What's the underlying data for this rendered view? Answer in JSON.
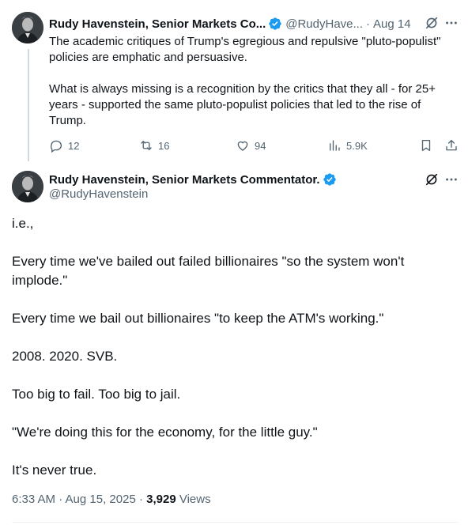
{
  "tweet1": {
    "author_name": "Rudy Havenstein, Senior Markets Co...",
    "handle": "@RudyHave...",
    "separator": "·",
    "date": "Aug 14",
    "paragraphs": [
      "The academic critiques of Trump's egregious and repulsive \"pluto-populist\" policies are emphatic and persuasive.",
      "What is always missing is a recognition by the critics that they all - for 25+ years - supported the same pluto-populist policies that led to the rise of Trump."
    ],
    "actions": {
      "replies": "12",
      "reposts": "16",
      "likes": "94",
      "views": "5.9K"
    }
  },
  "tweet2": {
    "author_name": "Rudy Havenstein, Senior Markets Commentator.",
    "handle": "@RudyHavenstein",
    "paragraphs": [
      "i.e.,",
      "Every time we've bailed out failed billionaires \"so the system won't implode.\"",
      "Every time we bail out billionaires \"to keep the ATM's working.\"",
      "2008. 2020. SVB.",
      "Too big to fail. Too big to jail.",
      "\"We're doing this for the economy, for the little guy.\"",
      "It's never true."
    ],
    "timestamp": "6:33 AM · Aug 15, 2025 · ",
    "views_count": "3,929",
    "views_label": " Views"
  },
  "icons": {
    "verified": "verified-badge-icon",
    "grok": "grok-icon",
    "more": "more-icon",
    "reply": "reply-icon",
    "repost": "repost-icon",
    "like": "heart-icon",
    "views": "views-icon",
    "bookmark": "bookmark-icon",
    "share": "share-icon"
  },
  "colors": {
    "text": "#0f1419",
    "secondary": "#536471",
    "verified": "#1d9bf0",
    "thread_line": "#cfd9de",
    "background": "#ffffff"
  }
}
